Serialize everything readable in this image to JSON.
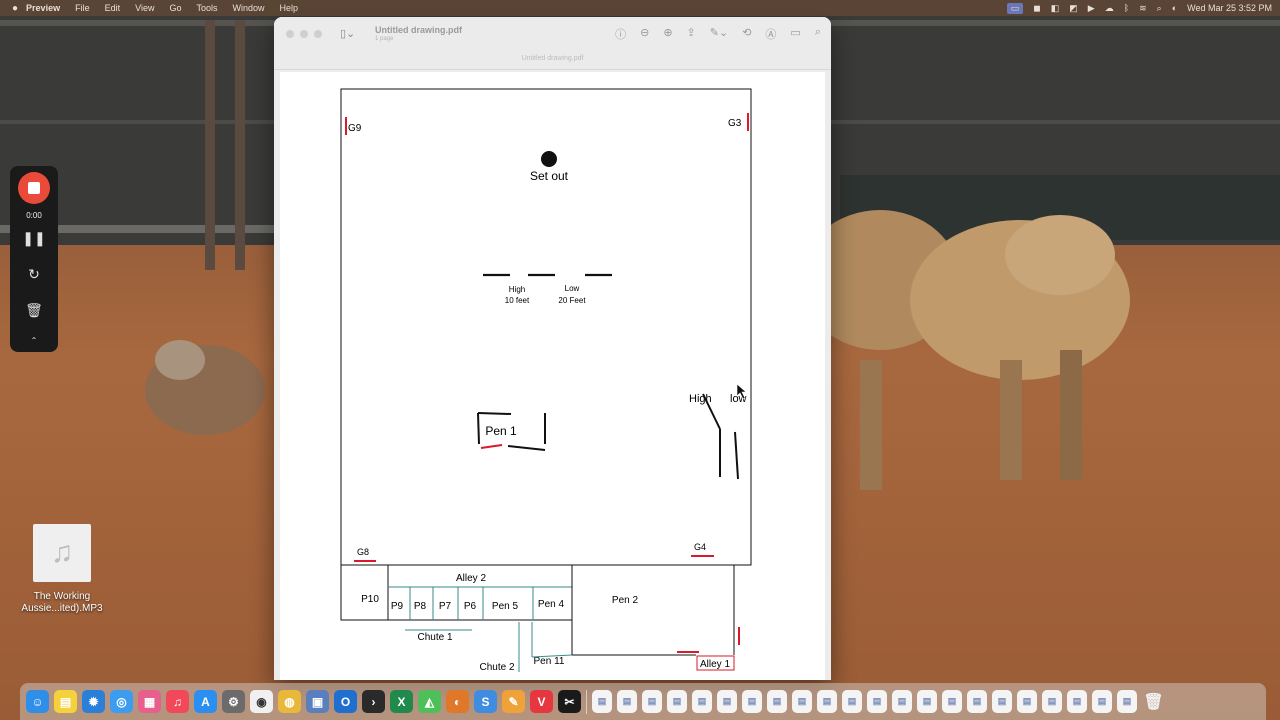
{
  "menubar": {
    "apple": "",
    "menus": [
      "Preview",
      "File",
      "Edit",
      "View",
      "Go",
      "Tools",
      "Window",
      "Help"
    ],
    "datetime": "Wed Mar 25  3:52 PM",
    "status_icons": [
      "screen-record-icon",
      "app-icon",
      "app-icon",
      "app-icon",
      "play-icon",
      "cloud-icon",
      "bluetooth-icon",
      "wifi-icon",
      "search-icon",
      "control-center-icon"
    ]
  },
  "window": {
    "title": "Untitled drawing.pdf",
    "subtitle": "1 page",
    "tab_label": "Untitled drawing.pdf",
    "toolbar_icons": [
      "info-icon",
      "zoom-out-icon",
      "zoom-in-icon",
      "share-icon",
      "markup-icon",
      "rotate-icon",
      "highlight-icon",
      "form-icon",
      "search-icon"
    ]
  },
  "drawing": {
    "labels": {
      "g9": "G9",
      "g3": "G3",
      "set_out": "Set out",
      "high_10": "High",
      "high_10_sub": "10 feet",
      "low_20": "Low",
      "low_20_sub": "20 Feet",
      "high_right": "High",
      "low_right": "low",
      "pen1": "Pen 1",
      "g8": "G8",
      "g4": "G4",
      "alley2": "Alley 2",
      "p10": "P10",
      "p9": "P9",
      "p8": "P8",
      "p7": "P7",
      "p6": "P6",
      "pen5": "Pen 5",
      "pen4": "Pen 4",
      "pen2": "Pen 2",
      "chute1": "Chute 1",
      "chute2": "Chute 2",
      "pen11": "Pen 11",
      "alley1": "Alley 1"
    },
    "gate_color": "#d91a2a",
    "line_color": "#111111"
  },
  "recorder": {
    "time": "0:00"
  },
  "desktop_file": {
    "name_line1": "The Working",
    "name_line2": "Aussie...ited).MP3"
  },
  "dock": {
    "apps": [
      {
        "name": "finder",
        "color": "#2f8fe8",
        "glyph": "☺"
      },
      {
        "name": "notes",
        "color": "#f5d23c",
        "glyph": "▤"
      },
      {
        "name": "system-settings",
        "color": "#2a7fd8",
        "glyph": "✹"
      },
      {
        "name": "safari",
        "color": "#3c9df0",
        "glyph": "◎"
      },
      {
        "name": "launchpad",
        "color": "#e85f8c",
        "glyph": "▦"
      },
      {
        "name": "music",
        "color": "#f2495a",
        "glyph": "♫"
      },
      {
        "name": "app-store",
        "color": "#2a8ff0",
        "glyph": "A"
      },
      {
        "name": "settings",
        "color": "#6b6b6b",
        "glyph": "⚙"
      },
      {
        "name": "chatgpt",
        "color": "#f0f0f0",
        "glyph": "◉"
      },
      {
        "name": "chrome",
        "color": "#e9b83a",
        "glyph": "◍"
      },
      {
        "name": "preview",
        "color": "#5b7fbd",
        "glyph": "▣"
      },
      {
        "name": "outlook",
        "color": "#1f6fd0",
        "glyph": "O"
      },
      {
        "name": "terminal",
        "color": "#2a2a2a",
        "glyph": "›"
      },
      {
        "name": "excel",
        "color": "#1f8a4c",
        "glyph": "X"
      },
      {
        "name": "maps",
        "color": "#4fbf5a",
        "glyph": "◭"
      },
      {
        "name": "audio",
        "color": "#e0782a",
        "glyph": "◐"
      },
      {
        "name": "slack",
        "color": "#3f8de0",
        "glyph": "S"
      },
      {
        "name": "pencil",
        "color": "#f0a23a",
        "glyph": "✎"
      },
      {
        "name": "vivaldi",
        "color": "#e6363f",
        "glyph": "V"
      },
      {
        "name": "capcut",
        "color": "#1a1a1a",
        "glyph": "✂"
      }
    ],
    "docs_count": 22
  }
}
